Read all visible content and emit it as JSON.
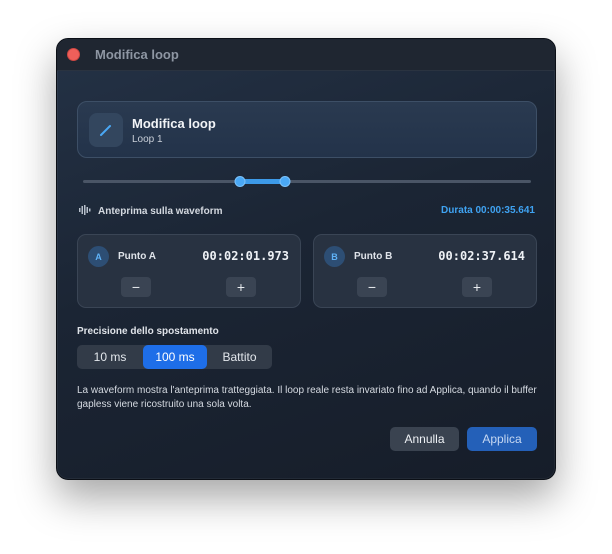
{
  "window": {
    "title": "Modifica loop"
  },
  "header": {
    "title": "Modifica loop",
    "subtitle": "Loop 1"
  },
  "range": {
    "start": 0.35,
    "end": 0.45
  },
  "waveform": {
    "label": "Anteprima sulla waveform",
    "duration": "Durata 00:00:35.641"
  },
  "point_a": {
    "badge": "A",
    "label": "Punto A",
    "time": "00:02:01.973",
    "minus": "−",
    "plus": "+"
  },
  "point_b": {
    "badge": "B",
    "label": "Punto B",
    "time": "00:02:37.614",
    "minus": "−",
    "plus": "+"
  },
  "precision": {
    "label": "Precisione dello spostamento",
    "options": [
      "10 ms",
      "100 ms",
      "Battito"
    ],
    "selected": "100 ms"
  },
  "info_text": "La waveform mostra l'anteprima tratteggiata. Il loop reale resta invariato fino ad Applica, quando il buffer gapless viene ricostruito una sola volta.",
  "actions": {
    "cancel": "Annulla",
    "apply": "Applica"
  },
  "colors": {
    "accent": "#3fa3f2",
    "selected": "#1e6ee8",
    "close": "#ee5f5a"
  }
}
